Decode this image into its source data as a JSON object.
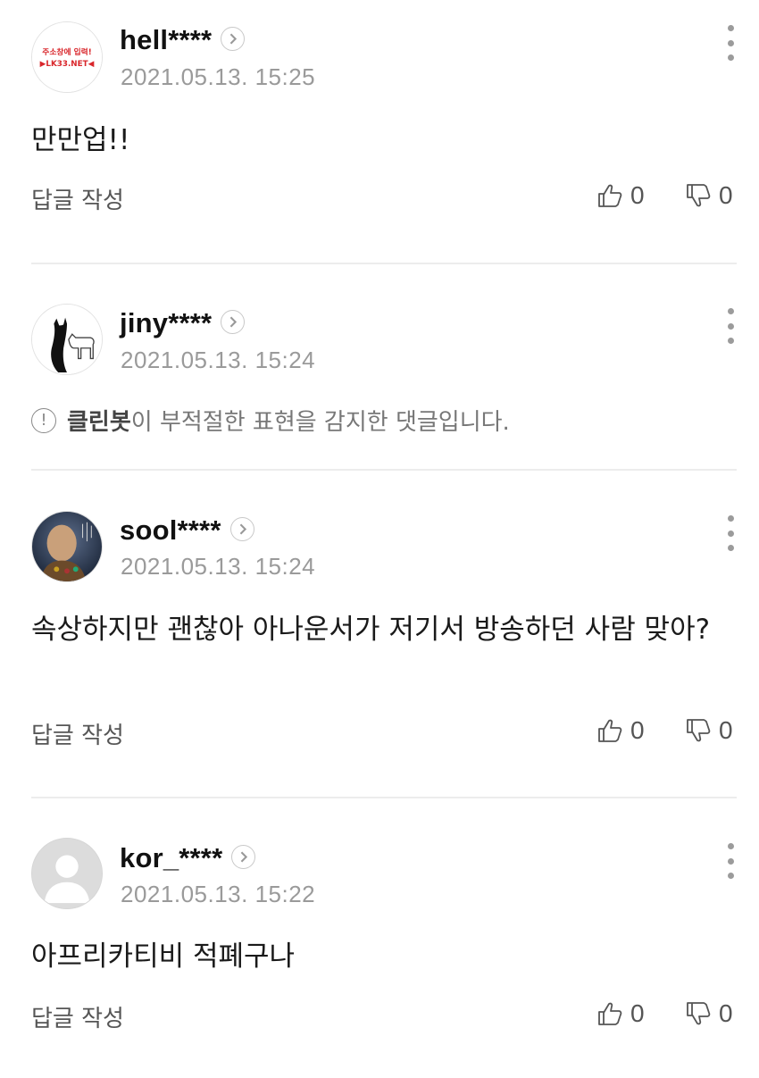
{
  "comments": [
    {
      "username": "hell****",
      "timestamp": "2021.05.13. 15:25",
      "avatar": {
        "icon": "red-text-logo-avatar",
        "line1": "주소창에 입력!",
        "line2": "▶LK33.NET◀",
        "color": "#d9262b"
      },
      "body": "만만업!!",
      "reply_label": "답글 작성",
      "likes": "0",
      "dislikes": "0"
    },
    {
      "username": "jiny****",
      "timestamp": "2021.05.13. 15:24",
      "avatar": {
        "icon": "cat-dog-avatar"
      },
      "cleanbot": {
        "strong": "클린봇",
        "rest": "이 부적절한 표현을 감지한 댓글입니다."
      }
    },
    {
      "username": "sool****",
      "timestamp": "2021.05.13. 15:24",
      "avatar": {
        "icon": "photo-avatar"
      },
      "body": "속상하지만 괜찮아 아나운서가 저기서 방송하던 사람 맞아?",
      "reply_label": "답글 작성",
      "likes": "0",
      "dislikes": "0"
    },
    {
      "username": "kor_****",
      "timestamp": "2021.05.13. 15:22",
      "avatar": {
        "icon": "default-user-avatar"
      },
      "body": "아프리카티비 적폐구나",
      "reply_label": "답글 작성",
      "likes": "0",
      "dislikes": "0"
    }
  ],
  "colors": {
    "text": "#111111",
    "meta": "#9a9a9a",
    "divider": "#ececec",
    "icon": "#555555"
  }
}
